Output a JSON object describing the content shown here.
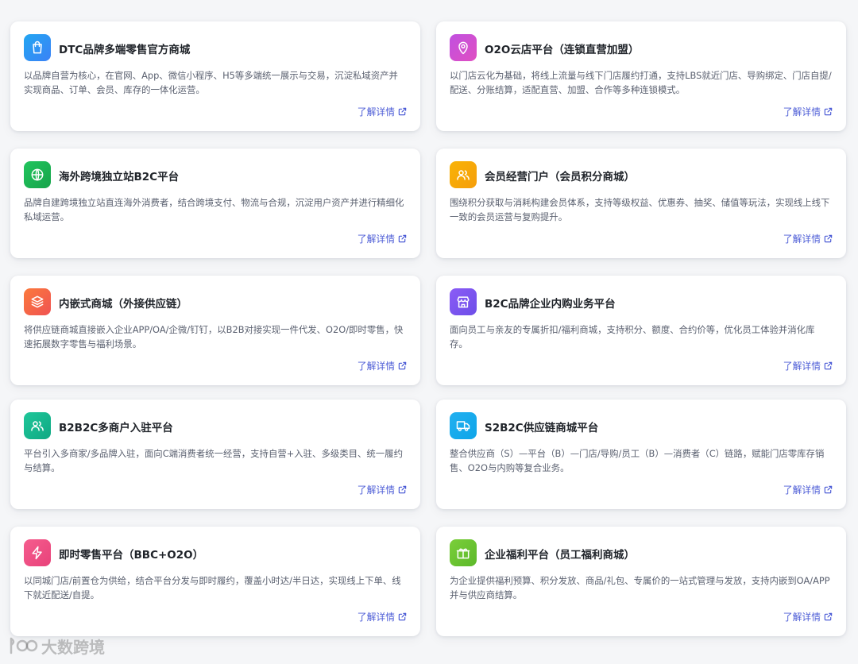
{
  "cards": [
    {
      "title": "DTC品牌多端零售官方商城",
      "desc": "以品牌自营为核心，在官网、App、微信小程序、H5等多端统一展示与交易，沉淀私域资产并实现商品、订单、会员、库存的一体化运营。",
      "more": "了解详情",
      "icon": "shopping-bag-icon",
      "color_from": "#22a6f2",
      "color_to": "#3b82f6"
    },
    {
      "title": "O2O云店平台（连锁直营加盟）",
      "desc": "以门店云化为基础，将线上流量与线下门店履约打通，支持LBS就近门店、导购绑定、门店自提/配送、分账结算，适配直营、加盟、合作等多种连锁模式。",
      "more": "了解详情",
      "icon": "map-pin-icon",
      "color_from": "#c050e0",
      "color_to": "#e04fc2"
    },
    {
      "title": "海外跨境独立站B2C平台",
      "desc": "品牌自建跨境独立站直连海外消费者，结合跨境支付、物流与合规，沉淀用户资产并进行精细化私域运营。",
      "more": "了解详情",
      "icon": "globe-icon",
      "color_from": "#22c55e",
      "color_to": "#16a34a"
    },
    {
      "title": "会员经营门户（会员积分商城）",
      "desc": "围绕积分获取与消耗构建会员体系，支持等级权益、优惠券、抽奖、储值等玩法，实现线上线下一致的会员运营与复购提升。",
      "more": "了解详情",
      "icon": "users-icon",
      "color_from": "#f9b307",
      "color_to": "#f59e0b"
    },
    {
      "title": "内嵌式商城（外接供应链）",
      "desc": "将供应链商城直接嵌入企业APP/OA/企微/钉钉，以B2B对接实现一件代发、O2O/即时零售，快速拓展数字零售与福利场景。",
      "more": "了解详情",
      "icon": "layers-icon",
      "color_from": "#fb7a3c",
      "color_to": "#f05252"
    },
    {
      "title": "B2C品牌企业内购业务平台",
      "desc": "面向员工与亲友的专属折扣/福利商城，支持积分、额度、合约价等，优化员工体验并消化库存。",
      "more": "了解详情",
      "icon": "store-icon",
      "color_from": "#8b5cf6",
      "color_to": "#6d4ee8"
    },
    {
      "title": "B2B2C多商户入驻平台",
      "desc": "平台引入多商家/多品牌入驻，面向C端消费者统一经营，支持自营+入驻、多级类目、统一履约与结算。",
      "more": "了解详情",
      "icon": "users-icon",
      "color_from": "#1fc79a",
      "color_to": "#0fa883"
    },
    {
      "title": "S2B2C供应链商城平台",
      "desc": "整合供应商（S）—平台（B）—门店/导购/员工（B）—消费者（C）链路，赋能门店零库存销售、O2O与内购等复合业务。",
      "more": "了解详情",
      "icon": "truck-icon",
      "color_from": "#22b0f0",
      "color_to": "#0ea5e9"
    },
    {
      "title": "即时零售平台（BBC+O2O）",
      "desc": "以同城门店/前置仓为供给，结合平台分发与即时履约，覆盖小时达/半日达，实现线上下单、线下就近配送/自提。",
      "more": "了解详情",
      "icon": "lightning-icon",
      "color_from": "#f55d8e",
      "color_to": "#e8427a"
    },
    {
      "title": "企业福利平台（员工福利商城）",
      "desc": "为企业提供福利预算、积分发放、商品/礼包、专属价的一站式管理与发放，支持内嵌到OA/APP并与供应商结算。",
      "more": "了解详情",
      "icon": "gift-icon",
      "color_from": "#7bcf3a",
      "color_to": "#5cb82a"
    }
  ],
  "watermark": {
    "text": "大数跨境",
    "icon": "logo-icon"
  }
}
